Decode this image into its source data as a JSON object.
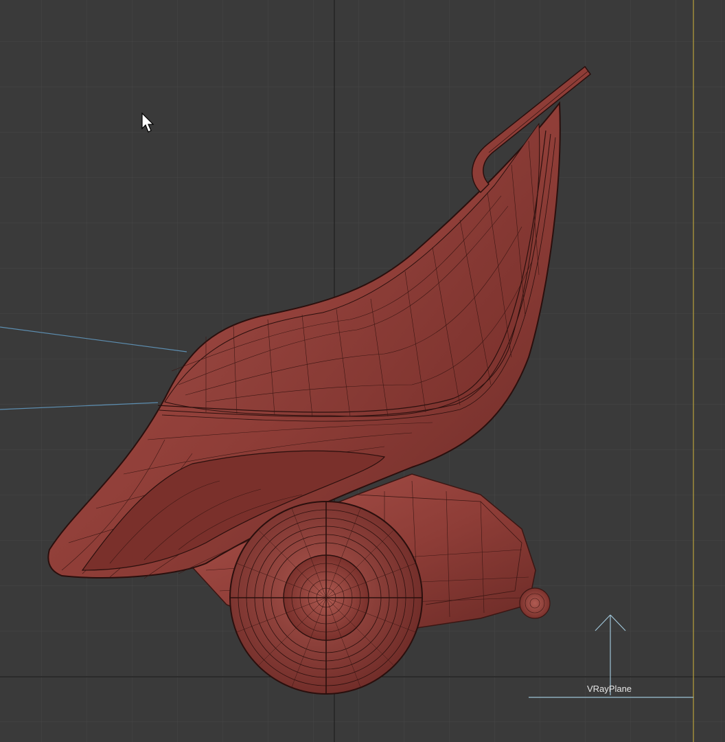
{
  "viewport": {
    "background_color": "#3a3a3a",
    "grid_color": "#4a4a4a",
    "model_color": "#8a3b36",
    "wire_color": "#2a1210",
    "gizmo_color": "#9ec3d6"
  },
  "objects": {
    "vray_plane_label": "VRayPlane"
  }
}
